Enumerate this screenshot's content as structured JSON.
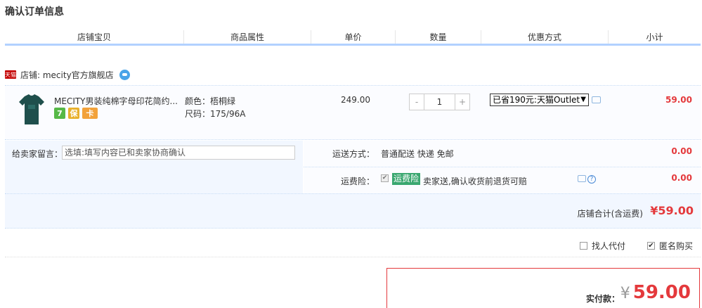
{
  "page_title": "确认订单信息",
  "columns": [
    "店铺宝贝",
    "商品属性",
    "单价",
    "数量",
    "优惠方式",
    "小计"
  ],
  "shop": {
    "badge": "天猫",
    "label": "店铺: mecity官方旗舰店"
  },
  "item": {
    "title": "MECITY男装纯棉字母印花简约...",
    "badges": [
      "7",
      "保",
      "卡"
    ],
    "color_attr": "颜色：梧桐绿",
    "size_attr": "尺码：175/96A",
    "price": "249.00",
    "qty_minus": "-",
    "qty": "1",
    "qty_plus": "+",
    "promo": "已省190元:天猫Outlet",
    "promo_arrow": "▼",
    "subtotal": "59.00"
  },
  "memo": {
    "label": "给卖家留言：",
    "placeholder": "选填:填写内容已和卖家协商确认"
  },
  "shipping": {
    "label": "运送方式：",
    "value": "普通配送 快递 免邮",
    "price": "0.00"
  },
  "insurance": {
    "label": "运费险：",
    "check": "✔",
    "tag": "运费险",
    "desc": "卖家送,确认收货前退货可赔",
    "help": "?",
    "price": "0.00"
  },
  "shop_total": {
    "label": "店铺合计(含运费)",
    "value": "¥59.00"
  },
  "options": {
    "proxy_pay": "找人代付",
    "anonymous": "匿名购买",
    "anonymous_check": "✔"
  },
  "payment": {
    "label": "实付款：",
    "currency": "¥",
    "amount": "59.00"
  },
  "colors": {
    "accent_red": "#e4393c",
    "header_line": "#b2d1ff",
    "insurance_green": "#3aa770"
  }
}
